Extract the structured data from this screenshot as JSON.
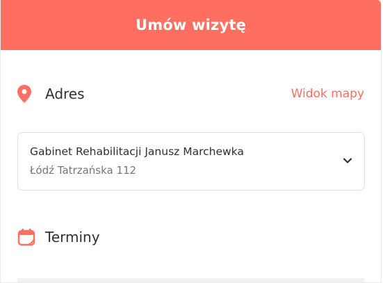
{
  "header": {
    "title": "Umów wizytę"
  },
  "address_section": {
    "title": "Adres",
    "map_link": "Widok mapy",
    "icon": "location-pin-icon"
  },
  "address_select": {
    "clinic_name": "Gabinet Rehabilitacji Janusz Marchewka",
    "clinic_address": "Łódź Tatrzańska 112",
    "icon": "chevron-down-icon"
  },
  "terms_section": {
    "title": "Terminy",
    "icon": "calendar-icon"
  },
  "colors": {
    "accent": "#ff6f61",
    "text": "#2f2f35",
    "muted": "#75757f",
    "border": "#dedee4"
  }
}
